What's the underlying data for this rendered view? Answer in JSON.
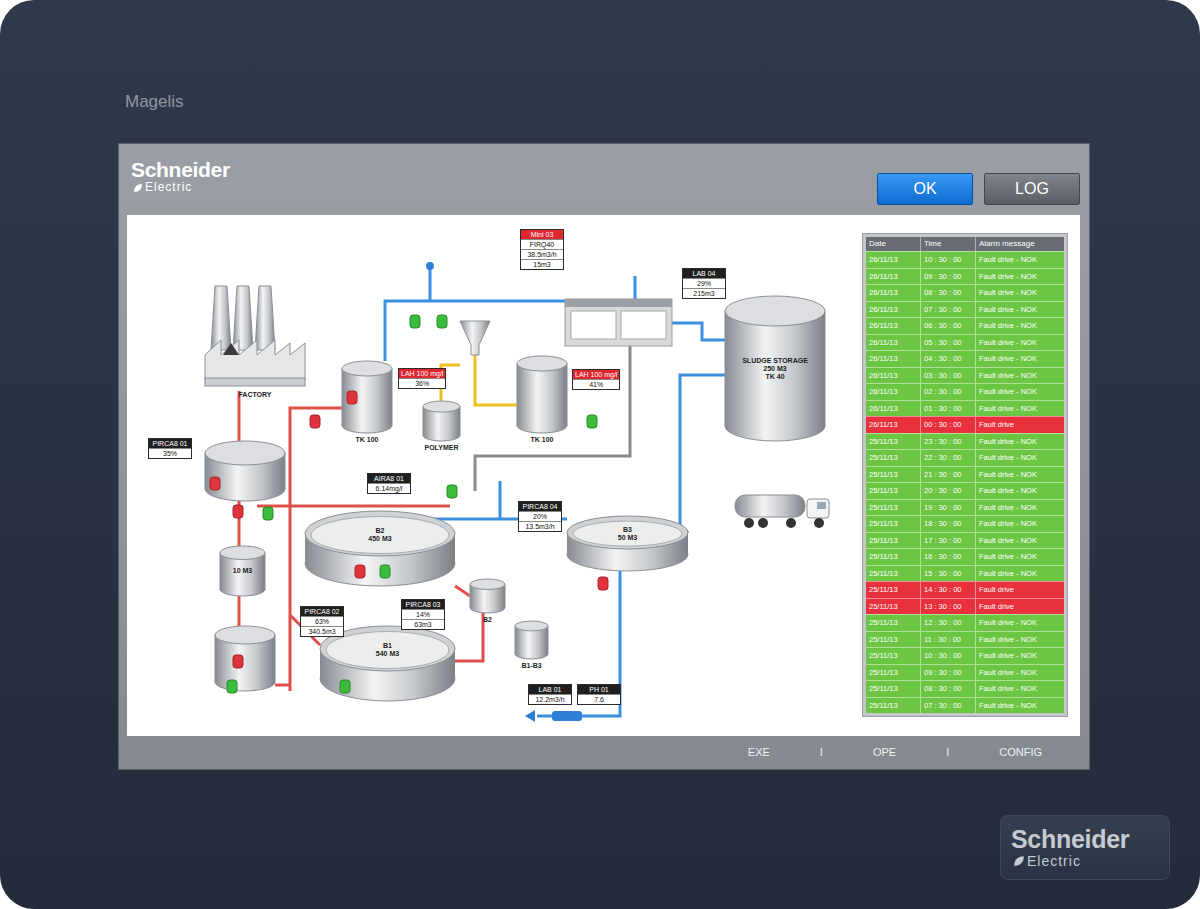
{
  "device": {
    "model": "Magelis"
  },
  "logo_top": {
    "brand": "Schneider",
    "sub": "Electric"
  },
  "logo_bezel": {
    "brand": "Schneider",
    "sub": "Electric"
  },
  "buttons": [
    {
      "label": "OK",
      "selected": true
    },
    {
      "label": "LOG",
      "selected": false
    }
  ],
  "diagram": {
    "factory": {
      "label": "FACTORY"
    },
    "vessels": [
      {
        "kind": "tank",
        "label": [
          "TK 100"
        ]
      },
      {
        "kind": "tank",
        "label": [
          "POLYMER"
        ]
      },
      {
        "kind": "tank",
        "label": [
          "TK 100"
        ]
      },
      {
        "kind": "silo",
        "label": [
          "SLUDGE STORAGE",
          "250 M3",
          "TK 40"
        ]
      },
      {
        "kind": "pool",
        "label": [
          "B2",
          "450 M3"
        ]
      },
      {
        "kind": "pool",
        "label": [
          "B1",
          "540 M3"
        ]
      },
      {
        "kind": "pool",
        "label": [
          "B3",
          "50 M3"
        ]
      },
      {
        "kind": "inner",
        "label": [
          "10 M3"
        ]
      },
      {
        "kind": "tank",
        "label": [
          "B2"
        ]
      },
      {
        "kind": "tank",
        "label": [
          "B1-B3"
        ]
      }
    ],
    "tags": [
      {
        "lines": [
          "PIRCA8 01",
          "35%"
        ],
        "alarm": false
      },
      {
        "lines": [
          "LAH 100 mg/l",
          "36%"
        ],
        "alarm": true
      },
      {
        "lines": [
          "LAH 100 mg/l",
          "41%"
        ],
        "alarm": true
      },
      {
        "lines": [
          "Mini 03",
          "FIRQ40",
          "38.5m3/h",
          "15m3"
        ],
        "alarm": true
      },
      {
        "lines": [
          "LAB 04",
          "29%",
          "215m3"
        ],
        "alarm": false
      },
      {
        "lines": [
          "AIRA8 01",
          "6.14mg/l"
        ],
        "alarm": false
      },
      {
        "lines": [
          "PIRCA8 04",
          "20%",
          "13.5m3/h"
        ],
        "alarm": false
      },
      {
        "lines": [
          "PIRCA8 02",
          "63%",
          "340.5m3"
        ],
        "alarm": false
      },
      {
        "lines": [
          "PIRCA8 03",
          "14%",
          "63m3"
        ],
        "alarm": false
      },
      {
        "lines": [
          "LAB 01",
          "12.2m3/h"
        ],
        "alarm": false
      },
      {
        "lines": [
          "PH 01",
          "7.6"
        ],
        "alarm": false
      }
    ],
    "valves": [
      {
        "open": true
      },
      {
        "open": true
      },
      {
        "open": false
      },
      {
        "open": false
      },
      {
        "open": true
      },
      {
        "open": false
      },
      {
        "open": false
      },
      {
        "open": true
      },
      {
        "open": true
      },
      {
        "open": false
      },
      {
        "open": true
      },
      {
        "open": true
      },
      {
        "open": false
      },
      {
        "open": true
      },
      {
        "open": false
      }
    ]
  },
  "alarms": {
    "columns": [
      "Date",
      "Time",
      "Alarm message"
    ],
    "rows": [
      {
        "date": "26/11/13",
        "time": "10 : 30 : 00",
        "message": "Fault drive - NOK",
        "color": "#6cc644"
      },
      {
        "date": "26/11/13",
        "time": "09 : 30 : 00",
        "message": "Fault drive - NOK",
        "color": "#6cc644"
      },
      {
        "date": "26/11/13",
        "time": "08 : 30 : 00",
        "message": "Fault drive - NOK",
        "color": "#6cc644"
      },
      {
        "date": "26/11/13",
        "time": "07 : 30 : 00",
        "message": "Fault drive - NOK",
        "color": "#6cc644"
      },
      {
        "date": "26/11/13",
        "time": "06 : 30 : 00",
        "message": "Fault drive - NOK",
        "color": "#6cc644"
      },
      {
        "date": "26/11/13",
        "time": "05 : 30 : 00",
        "message": "Fault drive - NOK",
        "color": "#6cc644"
      },
      {
        "date": "26/11/13",
        "time": "04 : 30 : 00",
        "message": "Fault drive - NOK",
        "color": "#6cc644"
      },
      {
        "date": "26/11/13",
        "time": "03 : 30 : 00",
        "message": "Fault drive - NOK",
        "color": "#6cc644"
      },
      {
        "date": "26/11/13",
        "time": "02 : 30 : 00",
        "message": "Fault drive - NOK",
        "color": "#6cc644"
      },
      {
        "date": "26/11/13",
        "time": "01 : 30 : 00",
        "message": "Fault drive - NOK",
        "color": "#6cc644"
      },
      {
        "date": "26/11/13",
        "time": "00 : 30 : 00",
        "message": "Fault drive",
        "color": "#e8313c"
      },
      {
        "date": "25/11/13",
        "time": "23 : 30 : 00",
        "message": "Fault drive - NOK",
        "color": "#6cc644"
      },
      {
        "date": "25/11/13",
        "time": "22 : 30 : 00",
        "message": "Fault drive - NOK",
        "color": "#6cc644"
      },
      {
        "date": "25/11/13",
        "time": "21 : 30 : 00",
        "message": "Fault drive - NOK",
        "color": "#6cc644"
      },
      {
        "date": "25/11/13",
        "time": "20 : 30 : 00",
        "message": "Fault drive - NOK",
        "color": "#6cc644"
      },
      {
        "date": "25/11/13",
        "time": "19 : 30 : 00",
        "message": "Fault drive - NOK",
        "color": "#6cc644"
      },
      {
        "date": "25/11/13",
        "time": "18 : 30 : 00",
        "message": "Fault drive - NOK",
        "color": "#6cc644"
      },
      {
        "date": "25/11/13",
        "time": "17 : 30 : 00",
        "message": "Fault drive - NOK",
        "color": "#6cc644"
      },
      {
        "date": "25/11/13",
        "time": "16 : 30 : 00",
        "message": "Fault drive - NOK",
        "color": "#6cc644"
      },
      {
        "date": "25/11/13",
        "time": "15 : 30 : 00",
        "message": "Fault drive - NOK",
        "color": "#6cc644"
      },
      {
        "date": "25/11/13",
        "time": "14 : 30 : 00",
        "message": "Fault drive",
        "color": "#e8313c"
      },
      {
        "date": "25/11/13",
        "time": "13 : 30 : 00",
        "message": "Fault drive",
        "color": "#e8313c"
      },
      {
        "date": "25/11/13",
        "time": "12 : 30 : 00",
        "message": "Fault drive - NOK",
        "color": "#6cc644"
      },
      {
        "date": "25/11/13",
        "time": "11 : 30 : 00",
        "message": "Fault drive - NOK",
        "color": "#6cc644"
      },
      {
        "date": "25/11/13",
        "time": "10 : 30 : 00",
        "message": "Fault drive - NOK",
        "color": "#6cc644"
      },
      {
        "date": "25/11/13",
        "time": "09 : 30 : 00",
        "message": "Fault drive - NOK",
        "color": "#6cc644"
      },
      {
        "date": "25/11/13",
        "time": "08 : 30 : 00",
        "message": "Fault drive - NOK",
        "color": "#6cc644"
      },
      {
        "date": "25/11/13",
        "time": "07 : 30 : 00",
        "message": "Fault drive - NOK",
        "color": "#6cc644"
      }
    ]
  },
  "footer": [
    "EXE",
    "I",
    "OPE",
    "I",
    "CONFIG"
  ]
}
